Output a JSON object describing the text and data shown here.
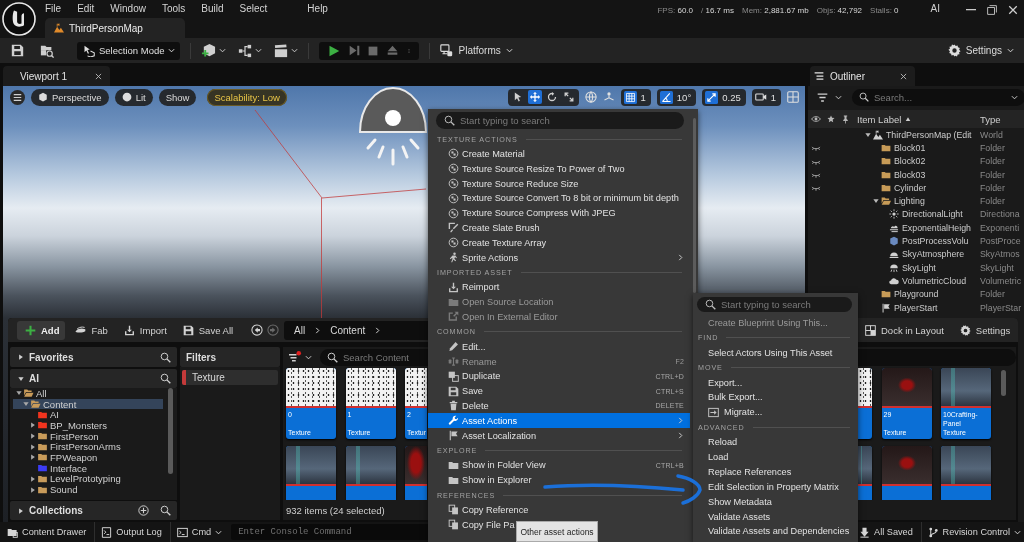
{
  "menubar": {
    "menus": [
      "File",
      "Edit",
      "Window",
      "Tools",
      "Build",
      "Select",
      "Help"
    ],
    "document_tab": "ThirdPersonMap",
    "stats": [
      {
        "label": "FPS:",
        "value": "60.0"
      },
      {
        "label": "/",
        "value": "16.7 ms"
      },
      {
        "label": "Mem:",
        "value": "2,881.67 mb"
      },
      {
        "label": "Objs:",
        "value": "42,792"
      },
      {
        "label": "Stalls:",
        "value": "0"
      }
    ],
    "user": "AI"
  },
  "toolbar": {
    "mode": "Selection Mode",
    "platforms": "Platforms",
    "settings": "Settings"
  },
  "viewport": {
    "tab": "Viewport 1",
    "view_mode": "Perspective",
    "lighting": "Lit",
    "show": "Show",
    "scalability": "Scalability: Low",
    "transform_tools": [
      {
        "kind": "select",
        "selected": false
      },
      {
        "kind": "move",
        "selected": true
      },
      {
        "kind": "rotate",
        "selected": false
      },
      {
        "kind": "scale",
        "selected": false
      }
    ],
    "snaps": [
      {
        "kind": "grid",
        "on": true,
        "value": "1"
      },
      {
        "kind": "angle",
        "on": true,
        "value": "10°"
      },
      {
        "kind": "scale",
        "on": true,
        "value": "0.25"
      }
    ],
    "camera_speed": "1"
  },
  "outliner": {
    "tab": "Outliner",
    "search_placeholder": "Search...",
    "columns": [
      "Item Label",
      "Type"
    ],
    "rows": [
      {
        "label": "ThirdPersonMap (Edit",
        "type": "World",
        "kind": "map",
        "hidden": false,
        "expanded": true,
        "children": [
          {
            "label": "Block01",
            "type": "Folder",
            "kind": "folder",
            "hidden": true,
            "expanded": false
          },
          {
            "label": "Block02",
            "type": "Folder",
            "kind": "folder",
            "hidden": true,
            "expanded": false
          },
          {
            "label": "Block03",
            "type": "Folder",
            "kind": "folder",
            "hidden": true,
            "expanded": false
          },
          {
            "label": "Cylinder",
            "type": "Folder",
            "kind": "folder",
            "hidden": true,
            "expanded": false
          },
          {
            "label": "Lighting",
            "type": "Folder",
            "kind": "folder",
            "hidden": false,
            "expanded": true,
            "children": [
              {
                "label": "DirectionalLight",
                "type": "Directiona",
                "kind": "directional-light",
                "hidden": false,
                "expanded": false
              },
              {
                "label": "ExponentialHeigh",
                "type": "Exponenti",
                "kind": "fog",
                "hidden": false,
                "expanded": false
              },
              {
                "label": "PostProcessVolu",
                "type": "PostProce",
                "kind": "volume",
                "hidden": false,
                "expanded": false
              },
              {
                "label": "SkyAtmosphere",
                "type": "SkyAtmos",
                "kind": "atmosphere",
                "hidden": false,
                "expanded": false
              },
              {
                "label": "SkyLight",
                "type": "SkyLight",
                "kind": "skylight",
                "hidden": false,
                "expanded": false
              },
              {
                "label": "VolumetricCloud",
                "type": "Volumetric",
                "kind": "cloud",
                "hidden": false,
                "expanded": false
              }
            ]
          },
          {
            "label": "Playground",
            "type": "Folder",
            "kind": "folder",
            "hidden": false,
            "expanded": false
          },
          {
            "label": "PlayerStart",
            "type": "PlayerStar",
            "kind": "player-start",
            "hidden": false,
            "expanded": false
          }
        ]
      }
    ]
  },
  "content_drawer": {
    "toolbar": {
      "buttons": [
        {
          "kind": "add",
          "label": "Add"
        },
        {
          "kind": "fab",
          "label": "Fab"
        },
        {
          "kind": "import",
          "label": "Import"
        },
        {
          "kind": "save",
          "label": "Save All"
        }
      ],
      "breadcrumb": [
        "All",
        "Content"
      ],
      "dock": "Dock in Layout",
      "settings": "Settings"
    },
    "sources": {
      "favorites": {
        "title": "Favorites",
        "expanded": false
      },
      "project": {
        "title": "AI",
        "expanded": true
      },
      "folders": [
        {
          "label": "All",
          "expandable": true,
          "expanded": true,
          "selected": false,
          "color": "#c89b5a",
          "children": [
            {
              "label": "Content",
              "expandable": true,
              "expanded": true,
              "selected": true,
              "color": "#c89b5a",
              "children": [
                {
                  "label": "AI",
                  "expandable": false,
                  "expanded": false,
                  "selected": false,
                  "color": "#f0341e"
                },
                {
                  "label": "BP_Monsters",
                  "expandable": true,
                  "expanded": false,
                  "selected": false,
                  "color": "#f0341e"
                },
                {
                  "label": "FirstPerson",
                  "expandable": true,
                  "expanded": false,
                  "selected": false,
                  "color": "#c89b5a"
                },
                {
                  "label": "FirstPersonArms",
                  "expandable": true,
                  "expanded": false,
                  "selected": false,
                  "color": "#c89b5a"
                },
                {
                  "label": "FPWeapon",
                  "expandable": true,
                  "expanded": false,
                  "selected": false,
                  "color": "#c89b5a"
                },
                {
                  "label": "Interface",
                  "expandable": false,
                  "expanded": false,
                  "selected": false,
                  "color": "#3c3cf5"
                },
                {
                  "label": "LevelPrototyping",
                  "expandable": true,
                  "expanded": false,
                  "selected": false,
                  "color": "#c89b5a"
                },
                {
                  "label": "Sound",
                  "expandable": true,
                  "expanded": false,
                  "selected": false,
                  "color": "#c89b5a"
                }
              ]
            }
          ]
        }
      ],
      "collections": {
        "title": "Collections",
        "expanded": false
      }
    },
    "filters": {
      "title": "Filters",
      "items": [
        {
          "label": "Texture",
          "color": "#c43a3a"
        }
      ]
    },
    "assets": {
      "search_placeholder": "Search Content",
      "tiles_left": [
        [
          {
            "name": "0",
            "type": "Texture",
            "kind": "noise",
            "selected": true
          },
          {
            "name": "1",
            "type": "Texture",
            "kind": "noise",
            "selected": true
          },
          {
            "name": "2",
            "type": "Textur",
            "kind": "noise",
            "selected": true
          }
        ],
        [
          {
            "kind": "screenshot",
            "selected": true
          },
          {
            "kind": "screenshot",
            "selected": true
          },
          {
            "kind": "night",
            "selected": true
          }
        ]
      ],
      "tiles_right": [
        [
          {
            "kind": "noise",
            "selected": true
          },
          {
            "name": "29",
            "type": "Texture",
            "kind": "night",
            "selected": true
          },
          {
            "name": "10Crafting-Panel",
            "type": "Texture",
            "kind": "screenshot",
            "selected": true
          }
        ],
        [
          {
            "kind": "screenshot",
            "selected": true
          },
          {
            "kind": "night",
            "selected": true
          },
          {
            "kind": "screenshot",
            "selected": true
          }
        ]
      ],
      "summary": "932 items (24 selected)"
    }
  },
  "status_bar": {
    "content_drawer": "Content Drawer",
    "output_log": "Output Log",
    "cmd": "Cmd",
    "console_placeholder": "Enter Console Command",
    "save_state": "All Saved",
    "revision_control": "Revision Control"
  },
  "context_menu": {
    "search_placeholder": "Start typing to search",
    "sections": [
      {
        "title": "TEXTURE ACTIONS",
        "items": [
          {
            "label": "Create Material",
            "kind": "texture",
            "disabled": false,
            "selected": false,
            "submenu": false
          },
          {
            "label": "Texture Source Resize To Power of Two",
            "kind": "texture",
            "disabled": false,
            "selected": false,
            "submenu": false
          },
          {
            "label": "Texture Source Reduce Size",
            "kind": "texture",
            "disabled": false,
            "selected": false,
            "submenu": false
          },
          {
            "label": "Texture Source Convert To 8 bit or minimum bit depth",
            "kind": "texture",
            "disabled": false,
            "selected": false,
            "submenu": false
          },
          {
            "label": "Texture Source Compress With JPEG",
            "kind": "texture",
            "disabled": false,
            "selected": false,
            "submenu": false
          },
          {
            "label": "Create Slate Brush",
            "kind": "brush",
            "disabled": false,
            "selected": false,
            "submenu": false
          },
          {
            "label": "Create Texture Array",
            "kind": "texture",
            "disabled": false,
            "selected": false,
            "submenu": false
          },
          {
            "label": "Sprite Actions",
            "kind": "sprite",
            "disabled": false,
            "selected": false,
            "submenu": true
          }
        ]
      },
      {
        "title": "IMPORTED ASSET",
        "items": [
          {
            "label": "Reimport",
            "kind": "import",
            "disabled": false,
            "selected": false,
            "submenu": false
          },
          {
            "label": "Open Source Location",
            "kind": "folder",
            "disabled": true,
            "selected": false,
            "submenu": false
          },
          {
            "label": "Open In External Editor",
            "kind": "external",
            "disabled": true,
            "selected": false,
            "submenu": false
          }
        ]
      },
      {
        "title": "COMMON",
        "items": [
          {
            "label": "Edit...",
            "kind": "pencil",
            "disabled": false,
            "selected": false,
            "submenu": false
          },
          {
            "label": "Rename",
            "kind": "rename",
            "shortcut": "F2",
            "disabled": true,
            "selected": false,
            "submenu": false
          },
          {
            "label": "Duplicate",
            "kind": "duplicate",
            "shortcut": "CTRL+D",
            "disabled": false,
            "selected": false,
            "submenu": false
          },
          {
            "label": "Save",
            "kind": "save",
            "shortcut": "CTRL+S",
            "disabled": false,
            "selected": false,
            "submenu": false
          },
          {
            "label": "Delete",
            "kind": "trash",
            "shortcut": "DELETE",
            "disabled": false,
            "selected": false,
            "submenu": false
          },
          {
            "label": "Asset Actions",
            "kind": "wrench",
            "disabled": false,
            "selected": true,
            "submenu": true
          },
          {
            "label": "Asset Localization",
            "kind": "flag",
            "disabled": false,
            "selected": false,
            "submenu": true
          }
        ]
      },
      {
        "title": "EXPLORE",
        "items": [
          {
            "label": "Show in Folder View",
            "kind": "folder",
            "shortcut": "CTRL+B",
            "disabled": false,
            "selected": false,
            "submenu": false
          },
          {
            "label": "Show in Explorer",
            "kind": "folder",
            "disabled": false,
            "selected": false,
            "submenu": false
          }
        ]
      },
      {
        "title": "REFERENCES",
        "items": [
          {
            "label": "Copy Reference",
            "kind": "copy",
            "disabled": false,
            "selected": false,
            "submenu": false
          },
          {
            "label": "Copy File Pa",
            "kind": "copy",
            "disabled": false,
            "selected": false,
            "submenu": false
          }
        ]
      }
    ]
  },
  "asset_actions_menu": {
    "search_placeholder": "Start typing to search",
    "sections": [
      {
        "items": [
          {
            "label": "Create Blueprint Using This...",
            "kind": "plain",
            "disabled": true
          }
        ]
      },
      {
        "title": "FIND",
        "items": [
          {
            "label": "Select Actors Using This Asset",
            "kind": "plain",
            "disabled": false
          }
        ]
      },
      {
        "title": "MOVE",
        "items": [
          {
            "label": "Export...",
            "kind": "plain",
            "disabled": false
          },
          {
            "label": "Bulk Export...",
            "kind": "plain",
            "disabled": false
          },
          {
            "label": "Migrate...",
            "kind": "migrate",
            "disabled": false
          }
        ]
      },
      {
        "title": "ADVANCED",
        "items": [
          {
            "label": "Reload",
            "kind": "plain",
            "disabled": false
          },
          {
            "label": "Load",
            "kind": "plain",
            "disabled": false
          },
          {
            "label": "Replace References",
            "kind": "plain",
            "disabled": false
          },
          {
            "label": "Edit Selection in Property Matrix",
            "kind": "plain",
            "disabled": false
          },
          {
            "label": "Show Metadata",
            "kind": "plain",
            "disabled": false
          },
          {
            "label": "Validate Assets",
            "kind": "plain",
            "disabled": false
          },
          {
            "label": "Validate Assets and Dependencies",
            "kind": "plain",
            "disabled": false
          }
        ]
      }
    ]
  },
  "tooltip": "Other asset actions"
}
